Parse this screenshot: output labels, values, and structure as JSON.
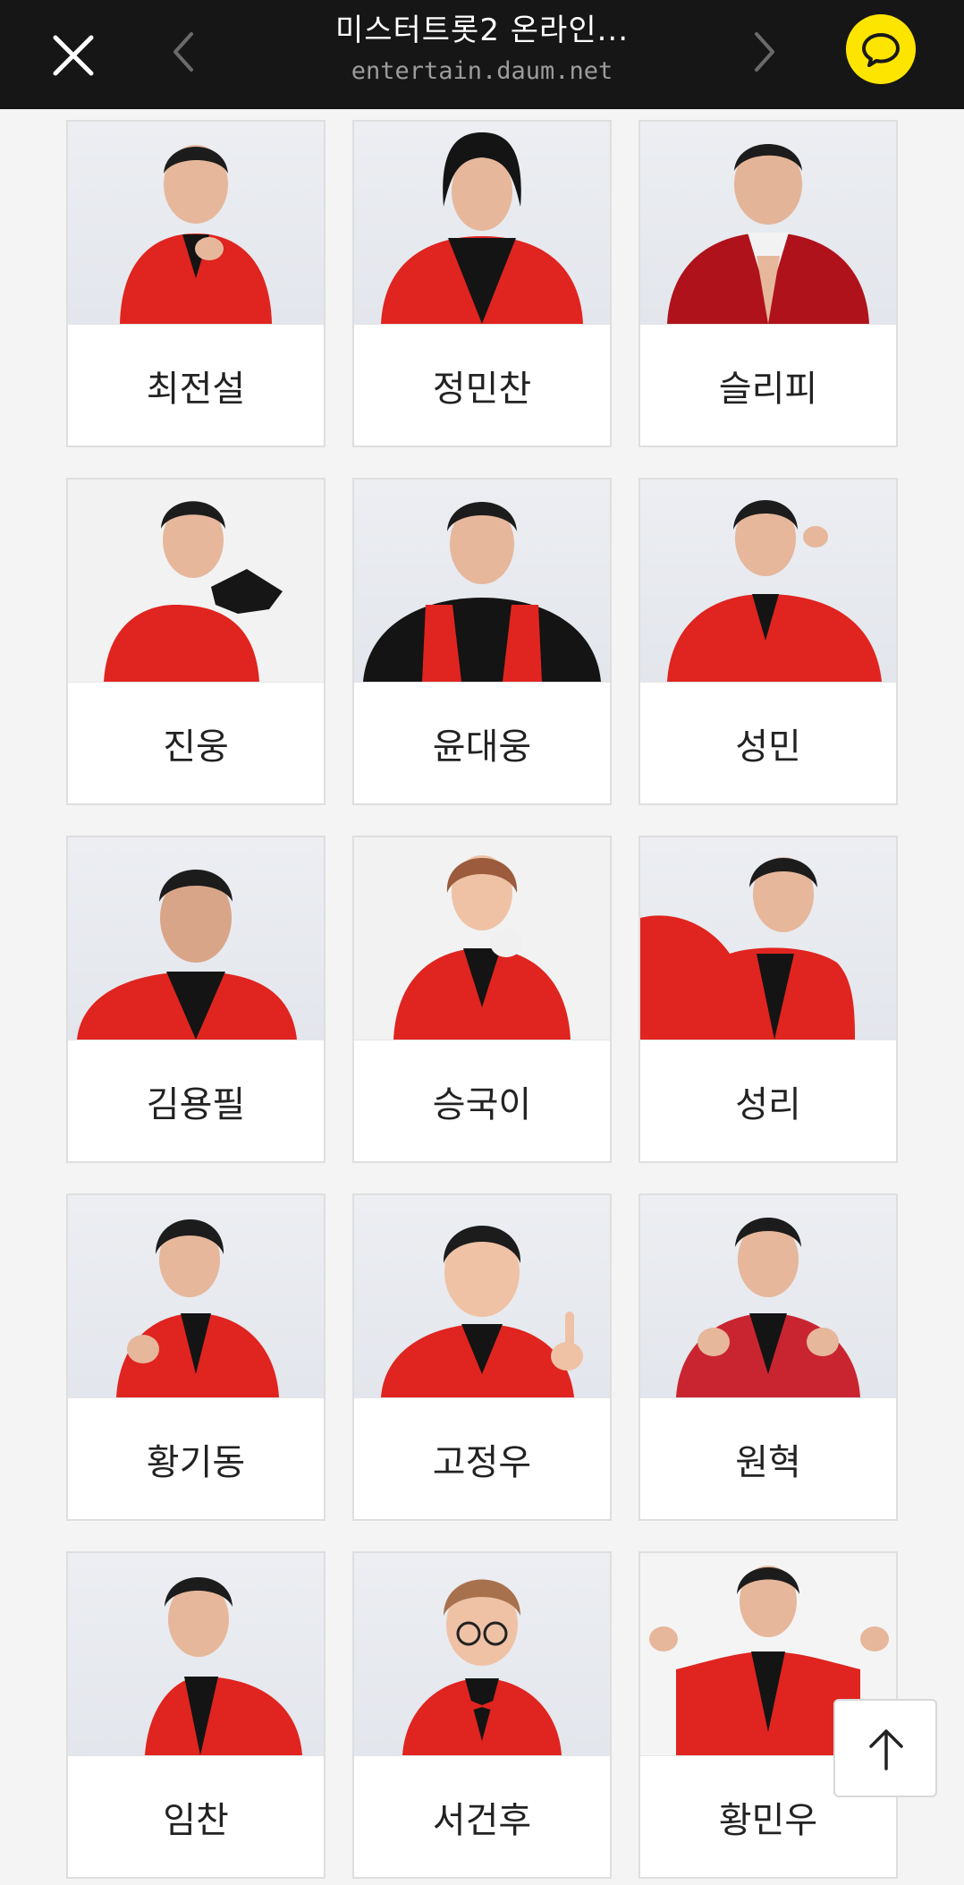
{
  "header": {
    "title": "미스터트롯2 온라인...",
    "url": "entertain.daum.net",
    "close_icon": "close-icon",
    "prev_icon": "chevron-left-icon",
    "next_icon": "chevron-right-icon",
    "share_icon": "kakaotalk-icon",
    "share_color": "#fee500"
  },
  "colors": {
    "accent_red": "#e0241f",
    "suit_dark": "#141414"
  },
  "cards": [
    {
      "name": "최전설"
    },
    {
      "name": "정민찬"
    },
    {
      "name": "슬리피"
    },
    {
      "name": "진웅"
    },
    {
      "name": "윤대웅"
    },
    {
      "name": "성민"
    },
    {
      "name": "김용필"
    },
    {
      "name": "승국이"
    },
    {
      "name": "성리"
    },
    {
      "name": "황기동"
    },
    {
      "name": "고정우"
    },
    {
      "name": "원혁"
    },
    {
      "name": "임찬"
    },
    {
      "name": "서건후"
    },
    {
      "name": "황민우"
    }
  ],
  "scroll_top_icon": "arrow-up-icon"
}
